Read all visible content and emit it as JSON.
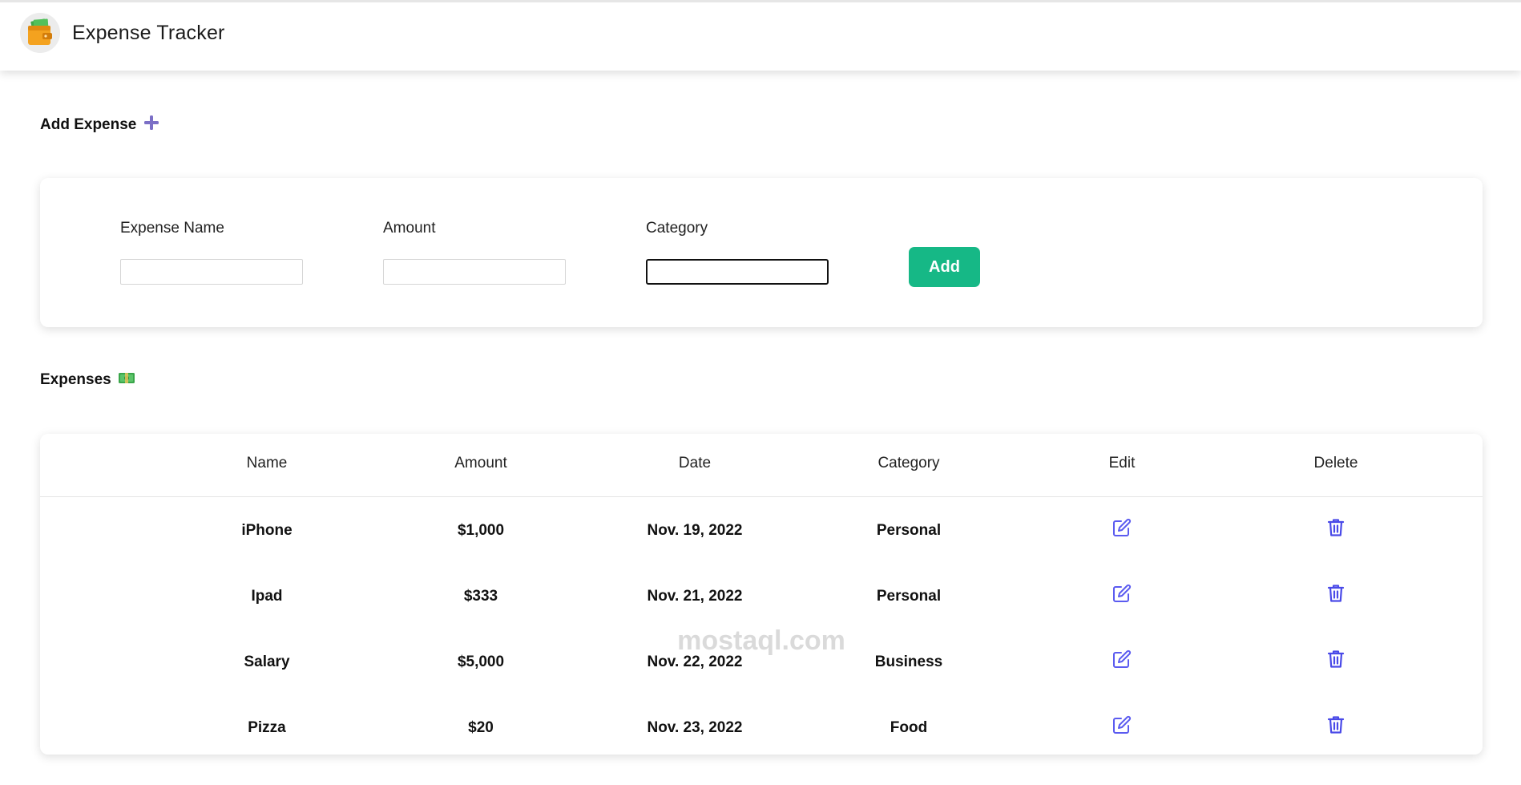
{
  "header": {
    "app_title": "Expense Tracker",
    "logo_icon": "wallet-money-icon"
  },
  "add_section": {
    "title": "Add Expense",
    "title_icon": "plus-icon",
    "fields": [
      {
        "label": "Expense Name",
        "value": "",
        "placeholder": ""
      },
      {
        "label": "Amount",
        "value": "",
        "placeholder": ""
      },
      {
        "label": "Category",
        "value": "",
        "placeholder": ""
      }
    ],
    "add_button": "Add"
  },
  "expenses_section": {
    "title": "Expenses",
    "title_icon": "money-icon",
    "columns": [
      "Name",
      "Amount",
      "Date",
      "Category",
      "Edit",
      "Delete"
    ],
    "rows": [
      {
        "name": "iPhone",
        "amount": "$1,000",
        "date": "Nov. 19, 2022",
        "category": "Personal"
      },
      {
        "name": "Ipad",
        "amount": "$333",
        "date": "Nov. 21, 2022",
        "category": "Personal"
      },
      {
        "name": "Salary",
        "amount": "$5,000",
        "date": "Nov. 22, 2022",
        "category": "Business"
      },
      {
        "name": "Pizza",
        "amount": "$20",
        "date": "Nov. 23, 2022",
        "category": "Food"
      }
    ],
    "edit_icon": "edit-icon",
    "delete_icon": "trash-icon"
  },
  "watermark": "mostaql.com",
  "colors": {
    "accent_green": "#16b886",
    "icon_blue": "#5b5bf0",
    "plus_purple": "#7b6fc6"
  }
}
